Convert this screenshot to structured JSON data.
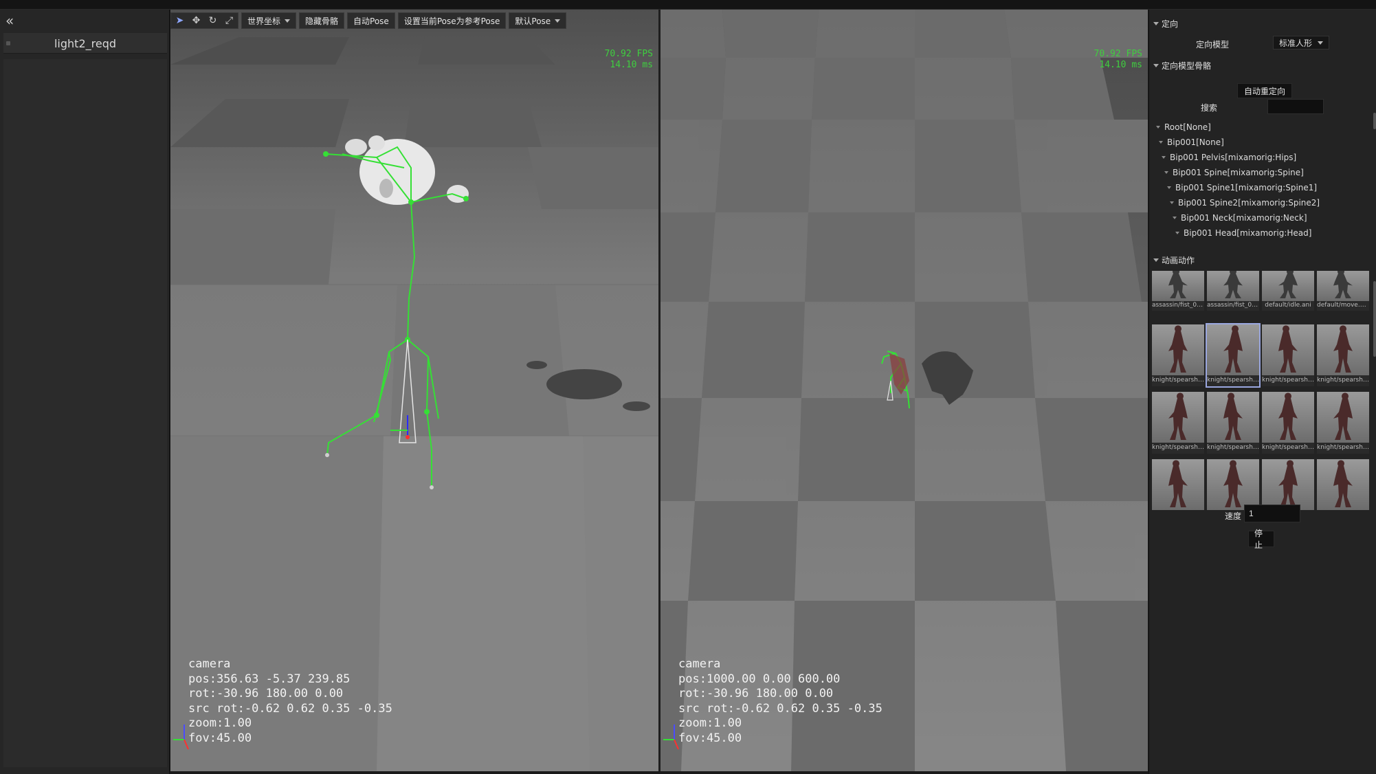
{
  "left_panel": {
    "collapse_icon": "double-chevron-left-icon",
    "items": [
      {
        "label": "light2_reqd"
      }
    ]
  },
  "toolbar": {
    "tools": [
      {
        "name": "select",
        "icon": "cursor-arrow-icon",
        "glyph": "➤",
        "active": true
      },
      {
        "name": "move",
        "icon": "move-arrows-icon",
        "glyph": "✥"
      },
      {
        "name": "rotate",
        "icon": "rotate-icon",
        "glyph": "↻"
      },
      {
        "name": "scale",
        "icon": "scale-icon",
        "glyph": "⤢"
      }
    ],
    "coord_label": "世界坐标",
    "hide_skeleton_label": "隐藏骨骼",
    "auto_pose_label": "自动Pose",
    "set_ref_pose_label": "设置当前Pose为参考Pose",
    "default_pose_label": "默认Pose"
  },
  "viewport_left": {
    "fps": "70.92 FPS",
    "ms": "14.10 ms",
    "camera": {
      "title": "camera",
      "pos": "pos:356.63 -5.37 239.85",
      "rot": "rot:-30.96 180.00 0.00",
      "src_rot": "src rot:-0.62 0.62 0.35 -0.35",
      "zoom": "zoom:1.00",
      "fov": "fov:45.00"
    }
  },
  "viewport_right": {
    "fps": "70.92 FPS",
    "ms": "14.10 ms",
    "camera": {
      "title": "camera",
      "pos": "pos:1000.00 0.00 600.00",
      "rot": "rot:-30.96 180.00 0.00",
      "src_rot": "src rot:-0.62 0.62 0.35 -0.35",
      "zoom": "zoom:1.00",
      "fov": "fov:45.00"
    }
  },
  "right_panel": {
    "section_retarget": "定向",
    "target_model_label": "定向模型",
    "target_model_value": "标准人形",
    "section_bones": "定向模型骨骼",
    "auto_retarget_button": "自动重定向",
    "search_label": "搜索",
    "search_value": "",
    "tree": [
      {
        "label": "Root[None]"
      },
      {
        "label": "Bip001[None]"
      },
      {
        "label": "Bip001 Pelvis[mixamorig:Hips]"
      },
      {
        "label": "Bip001 Spine[mixamorig:Spine]"
      },
      {
        "label": "Bip001 Spine1[mixamorig:Spine1]"
      },
      {
        "label": "Bip001 Spine2[mixamorig:Spine2]"
      },
      {
        "label": "Bip001 Neck[mixamorig:Neck]"
      },
      {
        "label": "Bip001 Head[mixamorig:Head]"
      }
    ],
    "section_anim": "动画动作",
    "anims": [
      {
        "caption": "assassin/fist_01..."
      },
      {
        "caption": "assassin/fist_01..."
      },
      {
        "caption": "default/idle.ani"
      },
      {
        "caption": "default/move.ani"
      },
      {
        "caption": "knight/spearshi..."
      },
      {
        "caption": "knight/spearshi...",
        "selected": true
      },
      {
        "caption": "knight/spearshi..."
      },
      {
        "caption": "knight/spearshi..."
      },
      {
        "caption": "knight/spearshi..."
      },
      {
        "caption": "knight/spearshi..."
      },
      {
        "caption": "knight/spearshi..."
      },
      {
        "caption": "knight/spearshi..."
      },
      {
        "caption": ""
      },
      {
        "caption": ""
      },
      {
        "caption": ""
      },
      {
        "caption": ""
      }
    ],
    "speed_label": "速度",
    "speed_value": "1",
    "stop_button": "停止"
  },
  "colors": {
    "fps_green": "#3fcf3f",
    "skeleton_green": "#35e035",
    "panel_bg": "#232323",
    "selection_outline": "#9aa7e0"
  }
}
